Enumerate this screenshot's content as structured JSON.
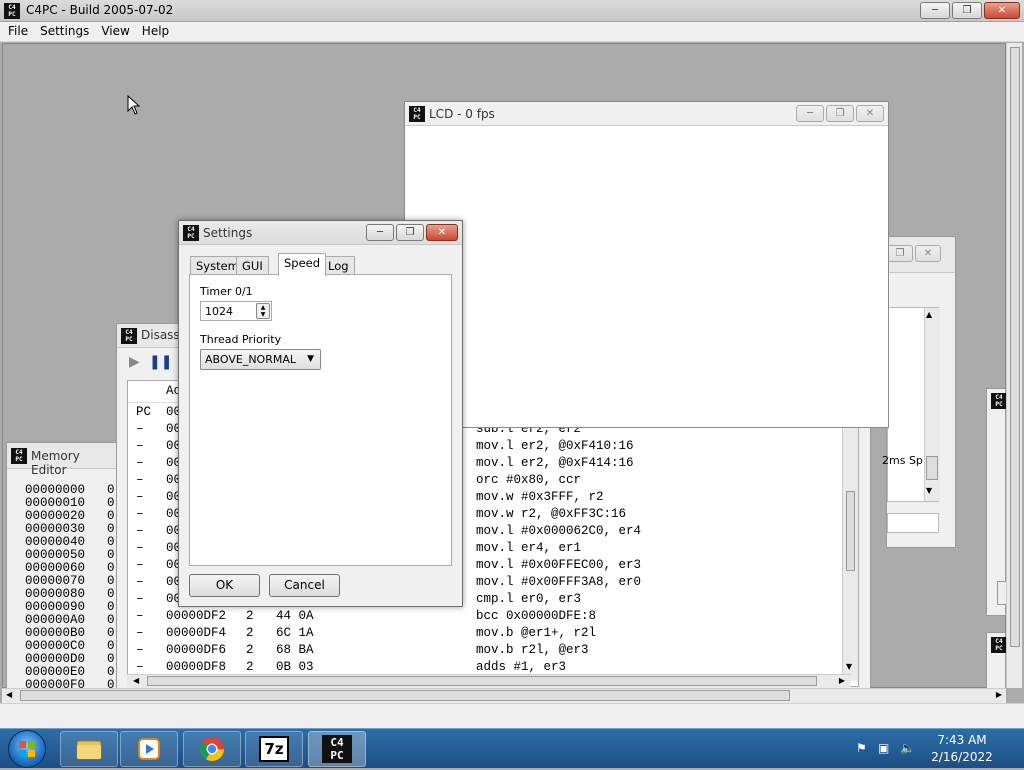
{
  "app": {
    "title": "C4PC - Build 2005-07-02",
    "logo_text": "C4PC"
  },
  "menu": [
    "File",
    "Settings",
    "View",
    "Help"
  ],
  "lcd": {
    "title": "LCD - 0 fps"
  },
  "disasm": {
    "title": "Disasse",
    "header_col": "Ac",
    "rows": [
      {
        "mark": "PC",
        "addr": "00",
        "len": "",
        "bytes": "",
        "instr": ""
      },
      {
        "mark": "–",
        "addr": "00",
        "len": "",
        "bytes": "",
        "instr": "sub.l er2, er2"
      },
      {
        "mark": "–",
        "addr": "00",
        "len": "",
        "bytes": "",
        "instr": "mov.l er2, @0xF410:16"
      },
      {
        "mark": "–",
        "addr": "00",
        "len": "",
        "bytes": "",
        "instr": "mov.l er2, @0xF414:16"
      },
      {
        "mark": "–",
        "addr": "00",
        "len": "",
        "bytes": "",
        "instr": "orc #0x80, ccr"
      },
      {
        "mark": "–",
        "addr": "00",
        "len": "",
        "bytes": "",
        "instr": "mov.w #0x3FFF, r2"
      },
      {
        "mark": "–",
        "addr": "00",
        "len": "",
        "bytes": "",
        "instr": "mov.w r2, @0xFF3C:16"
      },
      {
        "mark": "–",
        "addr": "00",
        "len": "",
        "bytes": "",
        "instr": "mov.l #0x000062C0, er4"
      },
      {
        "mark": "–",
        "addr": "00",
        "len": "",
        "bytes": "",
        "instr": "mov.l er4, er1"
      },
      {
        "mark": "–",
        "addr": "00",
        "len": "",
        "bytes": "",
        "instr": "mov.l #0x00FFEC00, er3"
      },
      {
        "mark": "–",
        "addr": "00",
        "len": "",
        "bytes": "",
        "instr": "mov.l #0x00FFF3A8, er0"
      },
      {
        "mark": "–",
        "addr": "00",
        "len": "",
        "bytes": "",
        "instr": "cmp.l er0, er3"
      },
      {
        "mark": "–",
        "addr": "00000DF2",
        "len": "2",
        "bytes": "44 0A",
        "instr": "bcc 0x00000DFE:8"
      },
      {
        "mark": "–",
        "addr": "00000DF4",
        "len": "2",
        "bytes": "6C 1A",
        "instr": "mov.b @er1+, r2l"
      },
      {
        "mark": "–",
        "addr": "00000DF6",
        "len": "2",
        "bytes": "68 BA",
        "instr": "mov.b r2l, @er3"
      },
      {
        "mark": "–",
        "addr": "00000DF8",
        "len": "2",
        "bytes": "0B 03",
        "instr": "adds #1, er3"
      }
    ]
  },
  "memedit": {
    "title": "Memory Editor",
    "addresses": [
      "00000000",
      "00000010",
      "00000020",
      "00000030",
      "00000040",
      "00000050",
      "00000060",
      "00000070",
      "00000080",
      "00000090",
      "000000A0",
      "000000B0",
      "000000C0",
      "000000D0",
      "000000E0",
      "000000F0"
    ],
    "col_fragment": "0"
  },
  "sidewin": {
    "fragment": "2ms Sp"
  },
  "settings": {
    "title": "Settings",
    "tabs": [
      "System",
      "GUI",
      "Speed",
      "Log"
    ],
    "active_tab": "Speed",
    "timer_label": "Timer 0/1",
    "timer_value": "1024",
    "thread_label": "Thread Priority",
    "thread_value": "ABOVE_NORMAL",
    "ok_label": "OK",
    "cancel_label": "Cancel"
  },
  "taskbar": {
    "apps": [
      "explorer",
      "media-player",
      "chrome",
      "7z",
      "c4pc"
    ],
    "sevenzip_label": "7z",
    "time": "7:43 AM",
    "date": "2/16/2022"
  }
}
